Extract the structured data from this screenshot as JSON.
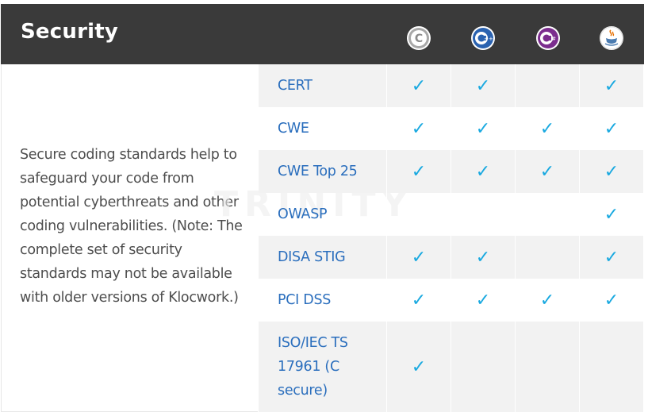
{
  "header": {
    "title": "Security",
    "languages": [
      {
        "icon": "c-language-icon",
        "color": "#9a9a9a",
        "glyph": "C",
        "suffix": ""
      },
      {
        "icon": "cpp-language-icon",
        "color": "#2a62b0",
        "glyph": "C",
        "suffix": "++"
      },
      {
        "icon": "csharp-language-icon",
        "color": "#7b2d8e",
        "glyph": "C",
        "suffix": "#"
      },
      {
        "icon": "java-language-icon",
        "color": "#e76f00",
        "glyph": "☕",
        "suffix": ""
      }
    ]
  },
  "description": "Secure coding standards help to safeguard your code from potential cyberthreats and other coding vulnerabilities. (Note: The complete set of security standards may not be available with older versions of Klocwork.)",
  "check_glyph": "✓",
  "colors": {
    "header_bg": "#3a3a3a",
    "link": "#2a6ebd",
    "check": "#19a9e0",
    "row_alt": "#f2f2f2"
  },
  "standards": [
    {
      "name": "CERT",
      "c": true,
      "cpp": true,
      "csharp": false,
      "java": true
    },
    {
      "name": "CWE",
      "c": true,
      "cpp": true,
      "csharp": true,
      "java": true
    },
    {
      "name": "CWE Top 25",
      "c": true,
      "cpp": true,
      "csharp": true,
      "java": true
    },
    {
      "name": "OWASP",
      "c": false,
      "cpp": false,
      "csharp": false,
      "java": true
    },
    {
      "name": "DISA STIG",
      "c": true,
      "cpp": true,
      "csharp": false,
      "java": true
    },
    {
      "name": "PCI DSS",
      "c": true,
      "cpp": true,
      "csharp": true,
      "java": true
    },
    {
      "name": "ISO/IEC TS 17961 (C secure)",
      "c": true,
      "cpp": false,
      "csharp": false,
      "java": false
    }
  ]
}
